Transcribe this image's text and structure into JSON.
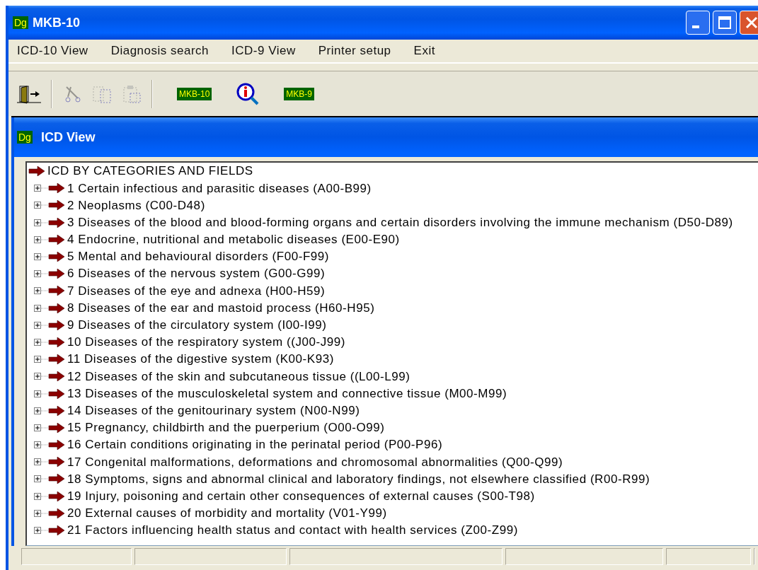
{
  "window": {
    "title": "MKB-10",
    "app_badge": "Dg"
  },
  "menu": [
    "ICD-10 View",
    "Diagnosis search",
    "ICD-9 View",
    "Printer setup",
    "Exit"
  ],
  "toolbar": [
    {
      "kind": "exit",
      "disabled": false
    },
    {
      "kind": "separator"
    },
    {
      "kind": "cut",
      "disabled": true
    },
    {
      "kind": "copy",
      "disabled": true
    },
    {
      "kind": "paste",
      "disabled": true
    },
    {
      "kind": "separator"
    },
    {
      "kind": "label",
      "text": "MKB-10",
      "disabled": false
    },
    {
      "kind": "info",
      "disabled": false
    },
    {
      "kind": "label",
      "text": "MKB-9",
      "disabled": false
    }
  ],
  "child_window": {
    "title": "ICD View",
    "app_badge": "Dg"
  },
  "tree": {
    "label": "ICD BY CATEGORIES AND FIELDS",
    "children": [
      {
        "label": "1 Certain infectious and parasitic diseases (A00-B99)",
        "expanded": false
      },
      {
        "label": "2 Neoplasms (C00-D48)",
        "expanded": false
      },
      {
        "label": "3 Diseases of the blood and blood-forming organs and certain disorders involving the immune mechanism (D50-D89)",
        "expanded": false
      },
      {
        "label": "4 Endocrine, nutritional and metabolic diseases (E00-E90)",
        "expanded": false
      },
      {
        "label": "5 Mental and behavioural disorders (F00-F99)",
        "expanded": false
      },
      {
        "label": "6 Diseases of the nervous system (G00-G99)",
        "expanded": false
      },
      {
        "label": "7 Diseases of the eye and adnexa (H00-H59)",
        "expanded": false
      },
      {
        "label": "8 Diseases of the ear and mastoid process (H60-H95)",
        "expanded": false
      },
      {
        "label": "9 Diseases of the circulatory system (I00-I99)",
        "expanded": false
      },
      {
        "label": "10 Diseases of the respiratory system ((J00-J99)",
        "expanded": false
      },
      {
        "label": "11 Diseases of the digestive system (K00-K93)",
        "expanded": false
      },
      {
        "label": "12 Diseases of the skin and subcutaneous tissue ((L00-L99)",
        "expanded": false
      },
      {
        "label": "13 Diseases of the musculoskeletal system and connective tissue (M00-M99)",
        "expanded": false
      },
      {
        "label": "14 Diseases of the genitourinary system (N00-N99)",
        "expanded": false
      },
      {
        "label": "15 Pregnancy, childbirth and the puerperium (O00-O99)",
        "expanded": false
      },
      {
        "label": "16 Certain conditions originating in the perinatal period (P00-P96)",
        "expanded": false
      },
      {
        "label": "17 Congenital malformations, deformations and chromosomal abnormalities (Q00-Q99)",
        "expanded": false
      },
      {
        "label": "18 Symptoms, signs and abnormal clinical and laboratory findings, not elsewhere classified (R00-R99)",
        "expanded": false
      },
      {
        "label": "19 Injury, poisoning and certain other consequences of external causes (S00-T98)",
        "expanded": false
      },
      {
        "label": "20 External causes of morbidity and mortality (V01-Y99)",
        "expanded": false
      },
      {
        "label": "21 Factors influencing health status and contact with health services (Z00-Z99)",
        "expanded": false
      }
    ]
  }
}
